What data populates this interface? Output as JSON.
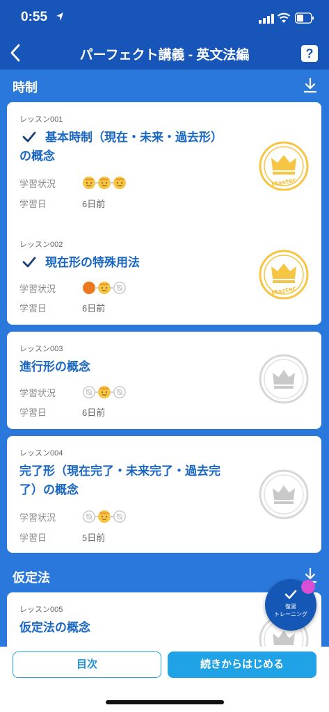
{
  "status_bar": {
    "time": "0:55"
  },
  "nav": {
    "title": "パーフェクト講義 - 英文法編"
  },
  "sections": [
    {
      "label": "時制"
    },
    {
      "label": "仮定法"
    }
  ],
  "lessons": [
    {
      "number": "レッスン001",
      "title_line1": "基本時制（現在・未来・過去形）",
      "title_line2": "の概念",
      "completed": true,
      "status_label": "学習状況",
      "date_label": "学習日",
      "date": "6日前",
      "mastered": true,
      "badge_text": "Master",
      "progress": [
        "done",
        "done",
        "done"
      ]
    },
    {
      "number": "レッスン002",
      "title_line1": "現在形の特殊用法",
      "title_line2": "",
      "completed": true,
      "status_label": "学習状況",
      "date_label": "学習日",
      "date": "6日前",
      "mastered": true,
      "badge_text": "Master",
      "progress": [
        "orange",
        "done",
        "empty"
      ]
    },
    {
      "number": "レッスン003",
      "title_line1": "進行形の概念",
      "title_line2": "",
      "completed": false,
      "status_label": "学習状況",
      "date_label": "学習日",
      "date": "6日前",
      "mastered": false,
      "badge_text": "",
      "progress": [
        "empty",
        "done",
        "empty"
      ]
    },
    {
      "number": "レッスン004",
      "title_line1": "完了形（現在完了・未来完了・過去完",
      "title_line2": "了）の概念",
      "completed": false,
      "status_label": "学習状況",
      "date_label": "学習日",
      "date": "5日前",
      "mastered": false,
      "badge_text": "",
      "progress": [
        "empty",
        "done",
        "empty"
      ]
    },
    {
      "number": "レッスン005",
      "title_line1": "仮定法の概念",
      "title_line2": "",
      "completed": false,
      "mastered": false
    }
  ],
  "fab": {
    "line1": "復習",
    "line2": "トレーニング"
  },
  "bottom": {
    "toc_label": "目次",
    "continue_label": "続きからはじめる"
  },
  "colors": {
    "header": "#1756b8",
    "background": "#2a78dc",
    "title": "#1a67c2",
    "gold": "#f6c543",
    "accent": "#1fa3e6"
  },
  "icons": [
    "location-arrow-icon",
    "signal-icon",
    "wifi-icon",
    "battery-icon",
    "back-chevron-icon",
    "help-icon",
    "download-icon",
    "check-icon",
    "crown-badge-icon",
    "progress-face-icon"
  ]
}
